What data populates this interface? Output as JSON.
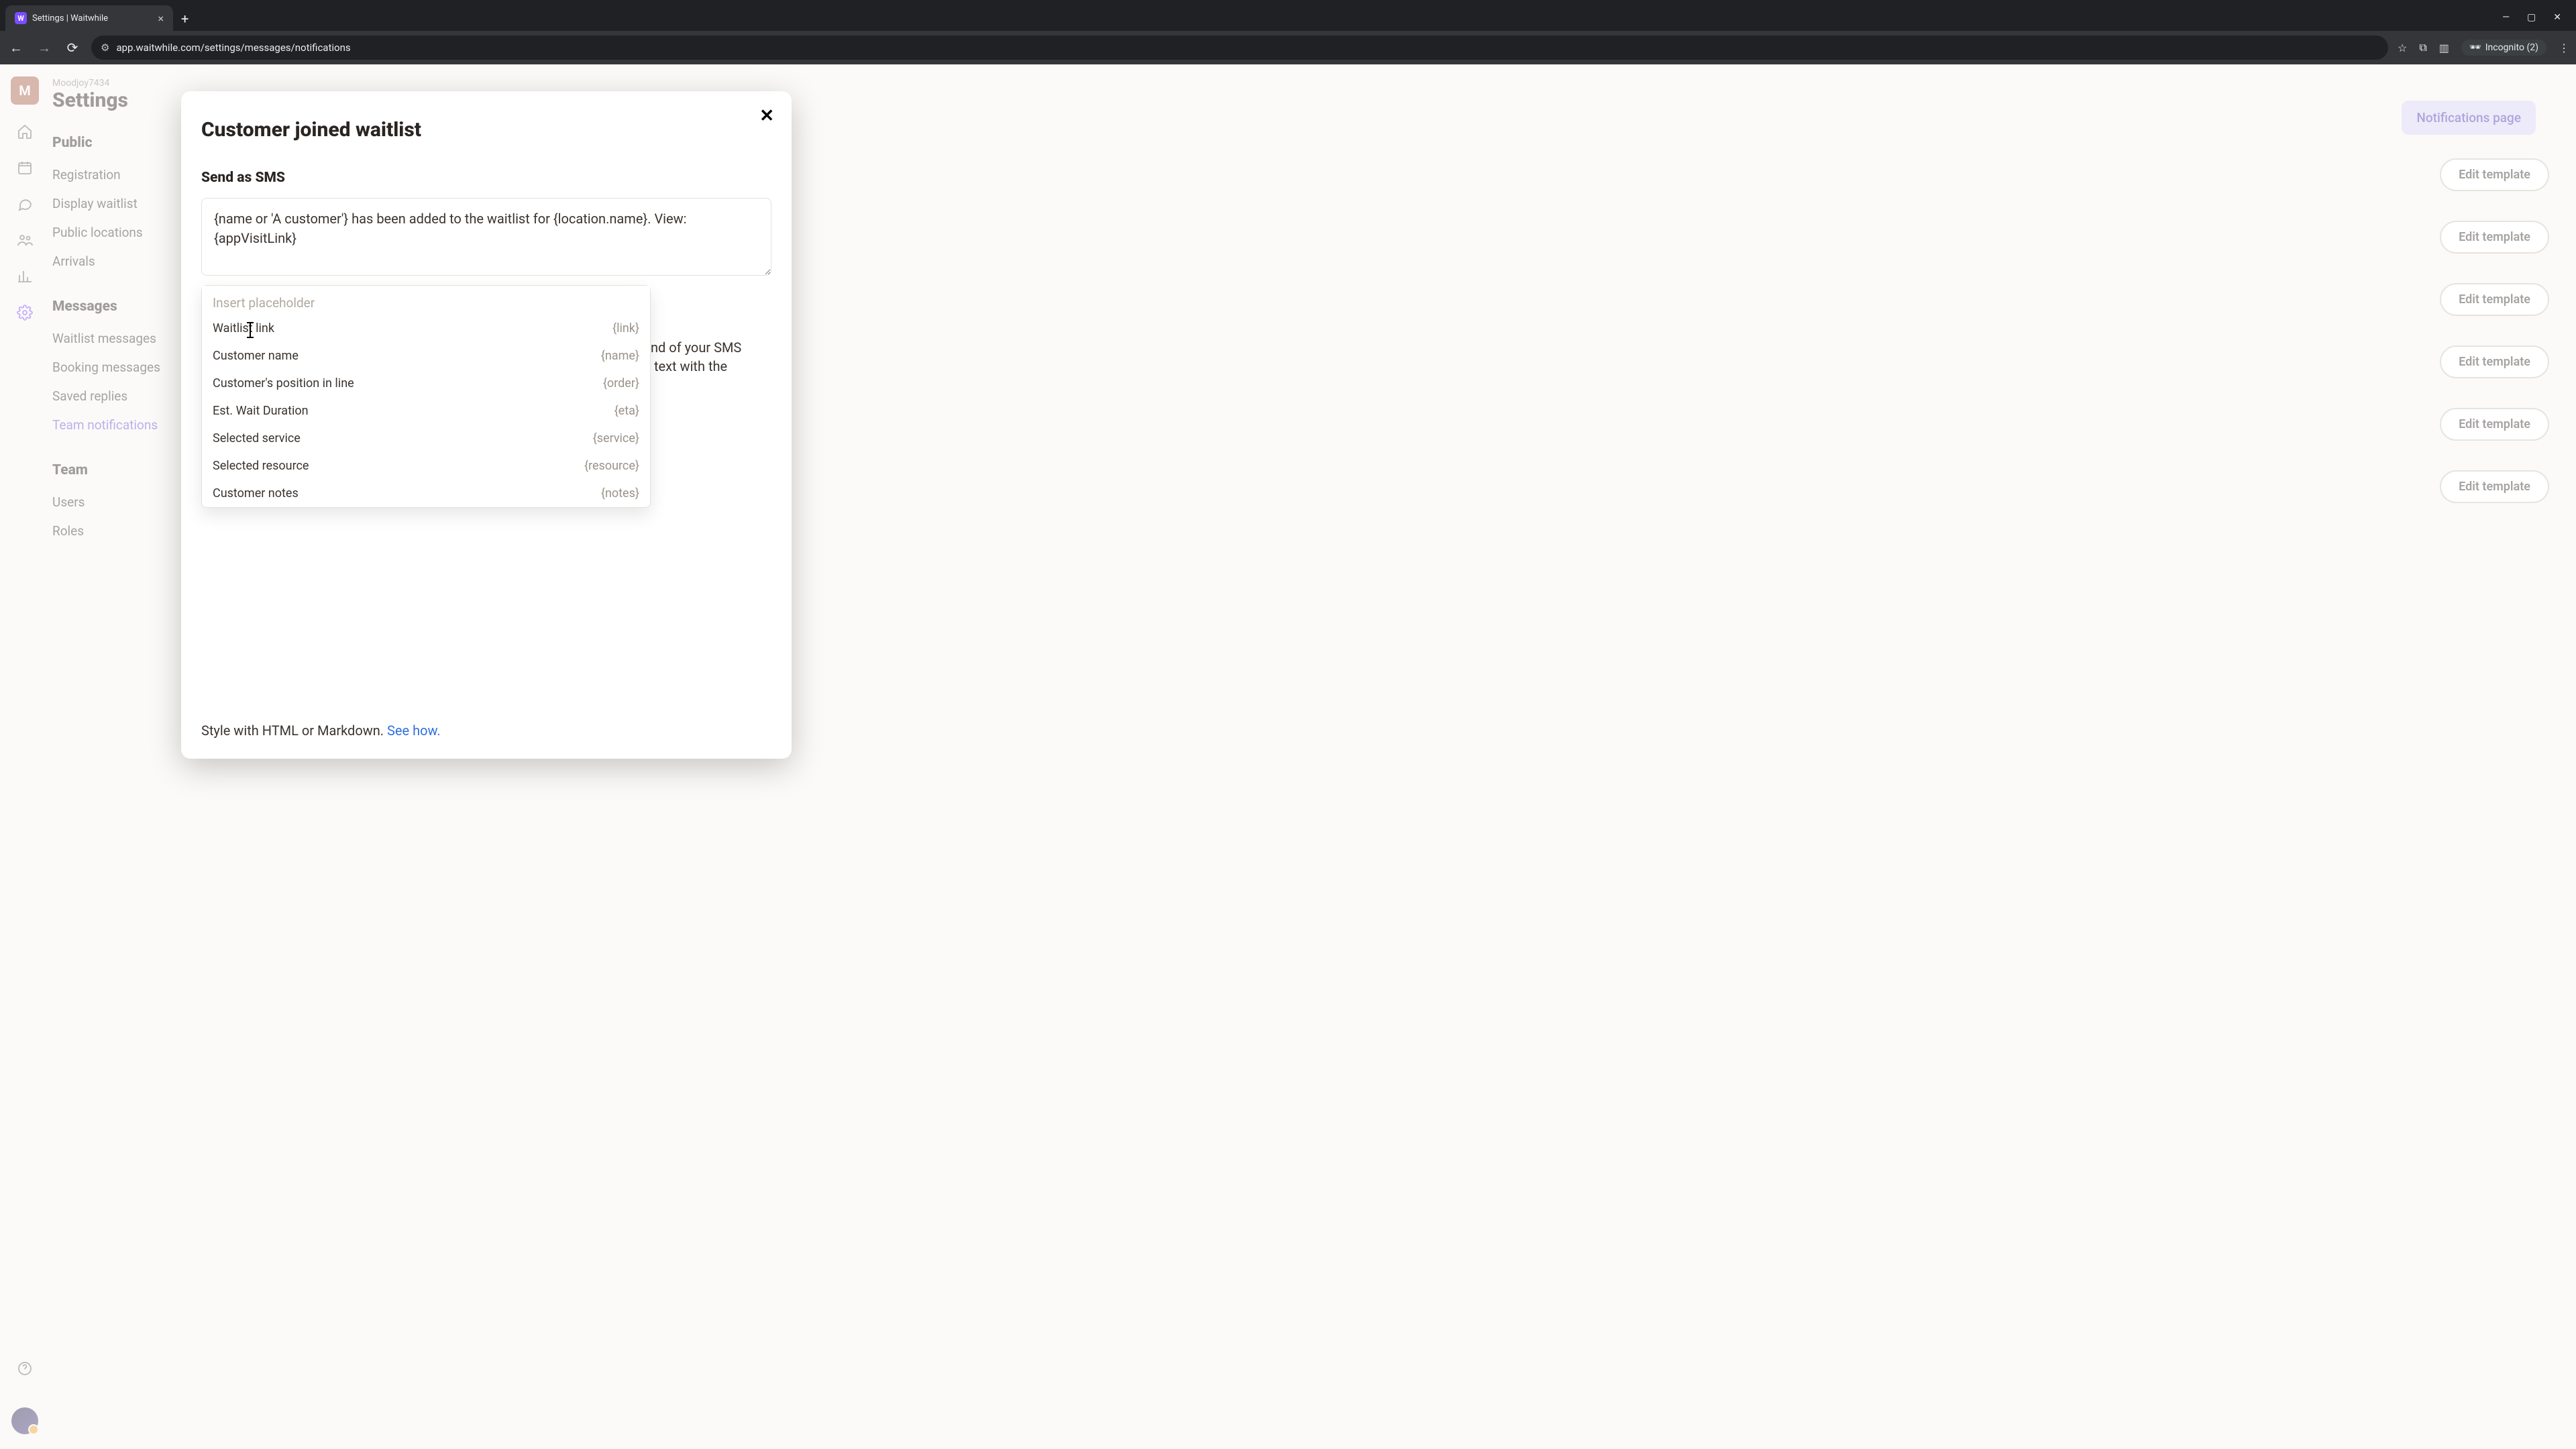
{
  "browser": {
    "tab_title": "Settings | Waitwhile",
    "url": "app.waitwhile.com/settings/messages/notifications",
    "incognito_label": "Incognito (2)"
  },
  "workspace": {
    "avatar_letter": "M",
    "org_name": "Moodjoy7434",
    "page_title": "Settings"
  },
  "sidebar": {
    "sections": [
      {
        "title": "Public",
        "items": [
          "Registration",
          "Display waitlist",
          "Public locations",
          "Arrivals"
        ]
      },
      {
        "title": "Messages",
        "items": [
          "Waitlist messages",
          "Booking messages",
          "Saved replies",
          "Team notifications"
        ],
        "active_index": 3
      },
      {
        "title": "Team",
        "items": [
          "Users",
          "Roles"
        ]
      }
    ]
  },
  "main": {
    "notifications_page_label": "Notifications page",
    "edit_template_label": "Edit template",
    "edit_button_count": 6,
    "behind_text_fragment_1": "nd of your SMS",
    "behind_text_fragment_2": " text with the"
  },
  "modal": {
    "title": "Customer joined waitlist",
    "send_as_sms_label": "Send as SMS",
    "sms_template": "{name or 'A customer'} has been added to the waitlist for {location.name}. View: {appVisitLink}",
    "placeholder_input_placeholder": "Insert placeholder",
    "placeholders": [
      {
        "label": "Waitlist link",
        "token": "{link}"
      },
      {
        "label": "Customer name",
        "token": "{name}"
      },
      {
        "label": "Customer's position in line",
        "token": "{order}"
      },
      {
        "label": "Est. Wait Duration",
        "token": "{eta}"
      },
      {
        "label": "Selected service",
        "token": "{service}"
      },
      {
        "label": "Selected resource",
        "token": "{resource}"
      },
      {
        "label": "Customer notes",
        "token": "{notes}"
      }
    ],
    "style_text": "Style with HTML or Markdown. ",
    "style_link": "See how."
  }
}
